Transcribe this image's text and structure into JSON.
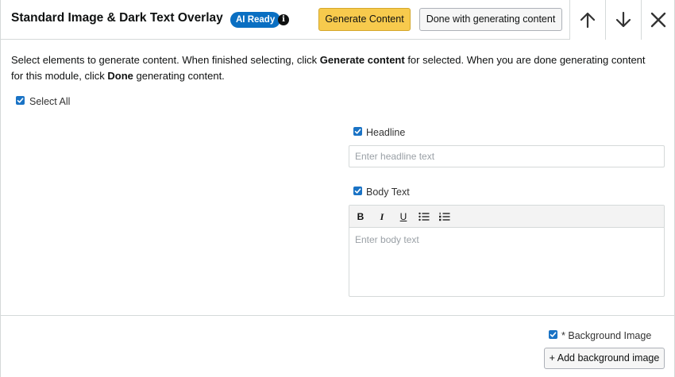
{
  "header": {
    "title": "Standard Image & Dark Text Overlay",
    "ai_badge": "AI Ready",
    "info_icon": "info-icon",
    "generate_label": "Generate Content",
    "done_label": "Done with generating content",
    "icons": [
      "arrow-up-icon",
      "arrow-down-icon",
      "close-icon"
    ]
  },
  "instructions": {
    "part1": "Select elements to generate content. When finished selecting, click ",
    "bold1": "Generate content",
    "part2": " for selected. When you are done generating content for this module, click ",
    "bold2": "Done",
    "part3": " generating content."
  },
  "select_all": {
    "label": "Select All",
    "checked": true
  },
  "headline": {
    "label": "Headline",
    "checked": true,
    "placeholder": "Enter headline text"
  },
  "body_text": {
    "label": "Body Text",
    "checked": true,
    "placeholder": "Enter body text",
    "toolbar": {
      "bold": "B",
      "italic": "I",
      "underline": "U",
      "icons": [
        "bulleted-list-icon",
        "numbered-list-icon"
      ]
    }
  },
  "background_image": {
    "required_marker": "*",
    "label": "Background Image",
    "checked": true,
    "add_label": "+ Add background image"
  },
  "colors": {
    "accent": "#1a73c5",
    "badge": "#0a6fc2",
    "primary_button": "#f7ca4d"
  }
}
